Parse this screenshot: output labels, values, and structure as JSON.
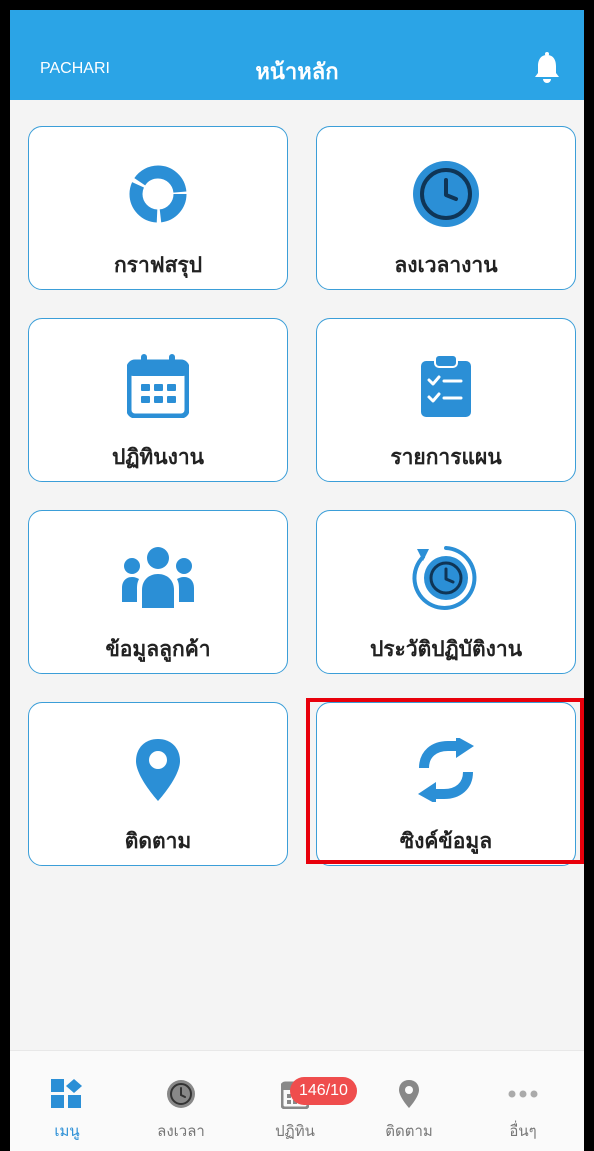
{
  "header": {
    "user": "PACHARI",
    "title": "หน้าหลัก",
    "bell_icon": "bell-icon"
  },
  "tiles": [
    {
      "label": "กราฟสรุป",
      "icon": "donut-chart-icon"
    },
    {
      "label": "ลงเวลางาน",
      "icon": "clock-icon"
    },
    {
      "label": "ปฏิทินงาน",
      "icon": "calendar-icon"
    },
    {
      "label": "รายการแผน",
      "icon": "clipboard-checklist-icon"
    },
    {
      "label": "ข้อมูลลูกค้า",
      "icon": "people-group-icon"
    },
    {
      "label": "ประวัติปฏิบัติงาน",
      "icon": "history-clock-icon"
    },
    {
      "label": "ติดตาม",
      "icon": "location-pin-icon"
    },
    {
      "label": "ซิงค์ข้อมูล",
      "icon": "sync-icon"
    }
  ],
  "bottom_nav": [
    {
      "label": "เมนู",
      "icon": "menu-grid-icon",
      "active": true
    },
    {
      "label": "ลงเวลา",
      "icon": "clock-icon"
    },
    {
      "label": "ปฏิทิน",
      "icon": "calendar-icon",
      "badge": "146/10"
    },
    {
      "label": "ติดตาม",
      "icon": "location-pin-icon"
    },
    {
      "label": "อื่นๆ",
      "icon": "more-dots-icon"
    }
  ],
  "colors": {
    "header": "#2ba4e6",
    "accent": "#2b8fd6",
    "highlight": "#e8000b",
    "badge": "#ef4d4d"
  }
}
